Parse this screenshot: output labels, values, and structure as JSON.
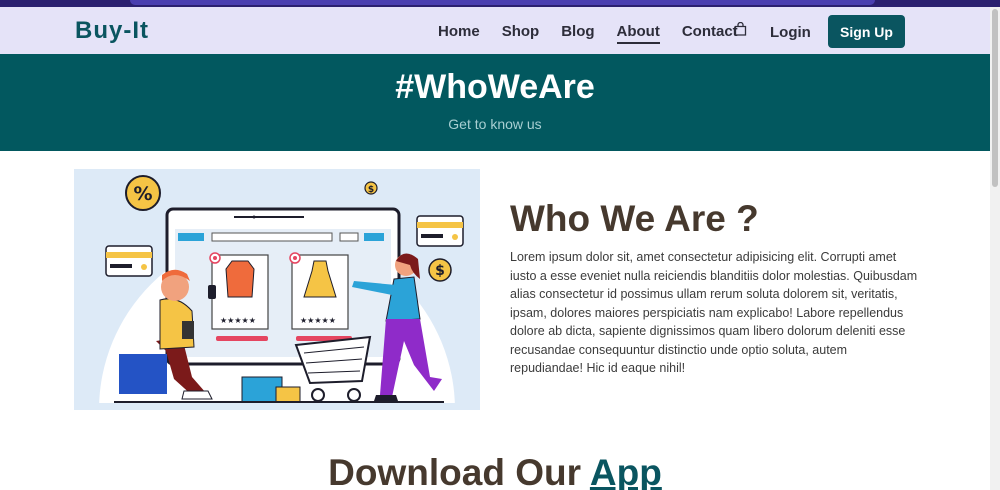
{
  "brand": "Buy-It",
  "nav": {
    "home": "Home",
    "shop": "Shop",
    "blog": "Blog",
    "about": "About",
    "contact": "Contact",
    "login": "Login",
    "signup": "Sign Up"
  },
  "hero": {
    "title": "#WhoWeAre",
    "subtitle": "Get to know us"
  },
  "about": {
    "title": "Who We Are ?",
    "body": "Lorem ipsum dolor sit, amet consectetur adipisicing elit. Corrupti amet iusto a esse eveniet nulla reiciendis blanditiis dolor molestias. Quibusdam alias consectetur id possimus ullam rerum soluta dolorem sit, veritatis, ipsam, dolores maiores perspiciatis nam explicabo! Labore repellendus dolore ab dicta, sapiente dignissimos quam libero dolorum deleniti esse recusandae consequuntur distinctio unde optio soluta, autem repudiandae! Hic id eaque nihil!"
  },
  "download": {
    "prefix": "Download Our ",
    "highlight": "App"
  },
  "illustration": {
    "percent_badge": "%",
    "coin_symbol": "$"
  },
  "colors": {
    "brand": "#0a5560",
    "hero_bg": "#02585f",
    "navbar_bg": "#e5e3f8",
    "heading": "#46392e"
  }
}
